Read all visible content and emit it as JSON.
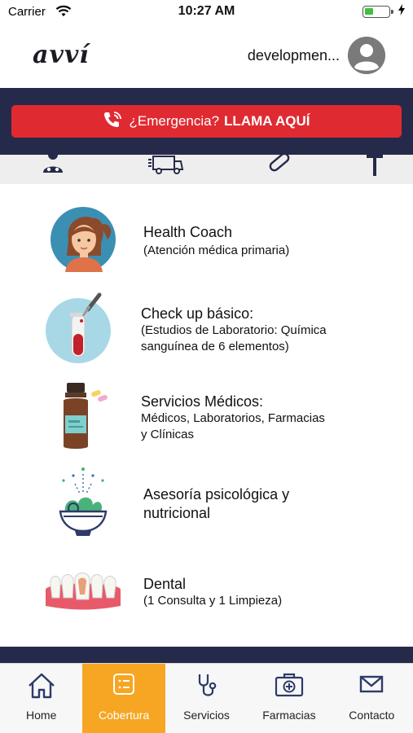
{
  "status_bar": {
    "carrier": "Carrier",
    "time": "10:27 AM"
  },
  "header": {
    "logo": "avví",
    "username": "developmen..."
  },
  "emergency": {
    "question": "¿Emergencia?",
    "cta": "LLAMA AQUÍ",
    "color": "#e02a32"
  },
  "colors": {
    "navy": "#262a4a",
    "accent": "#f6a623"
  },
  "benefits": [
    {
      "icon": "health-coach-avatar",
      "title": "Health Coach",
      "desc": "(Atención médica primaria)"
    },
    {
      "icon": "test-tube-icon",
      "title": "Check up básico:",
      "desc_lines": [
        "(Estudios de Laboratorio: Química",
        "sanguínea de 6 elementos)"
      ]
    },
    {
      "icon": "medicine-bottle-icon",
      "title": "Servicios Médicos:",
      "desc_lines": [
        "Médicos, Laboratorios, Farmacias",
        "y Clínicas"
      ]
    },
    {
      "icon": "salad-bowl-icon",
      "title_lines": [
        "Asesoría psicológica y",
        "nutricional"
      ]
    },
    {
      "icon": "teeth-icon",
      "title": "Dental",
      "desc": "(1 Consulta y 1 Limpieza)"
    }
  ],
  "tabs": [
    {
      "label": "Home",
      "icon": "home-icon",
      "active": false
    },
    {
      "label": "Cobertura",
      "icon": "list-card-icon",
      "active": true
    },
    {
      "label": "Servicios",
      "icon": "stethoscope-icon",
      "active": false
    },
    {
      "label": "Farmacias",
      "icon": "medkit-icon",
      "active": false
    },
    {
      "label": "Contacto",
      "icon": "envelope-icon",
      "active": false
    }
  ]
}
